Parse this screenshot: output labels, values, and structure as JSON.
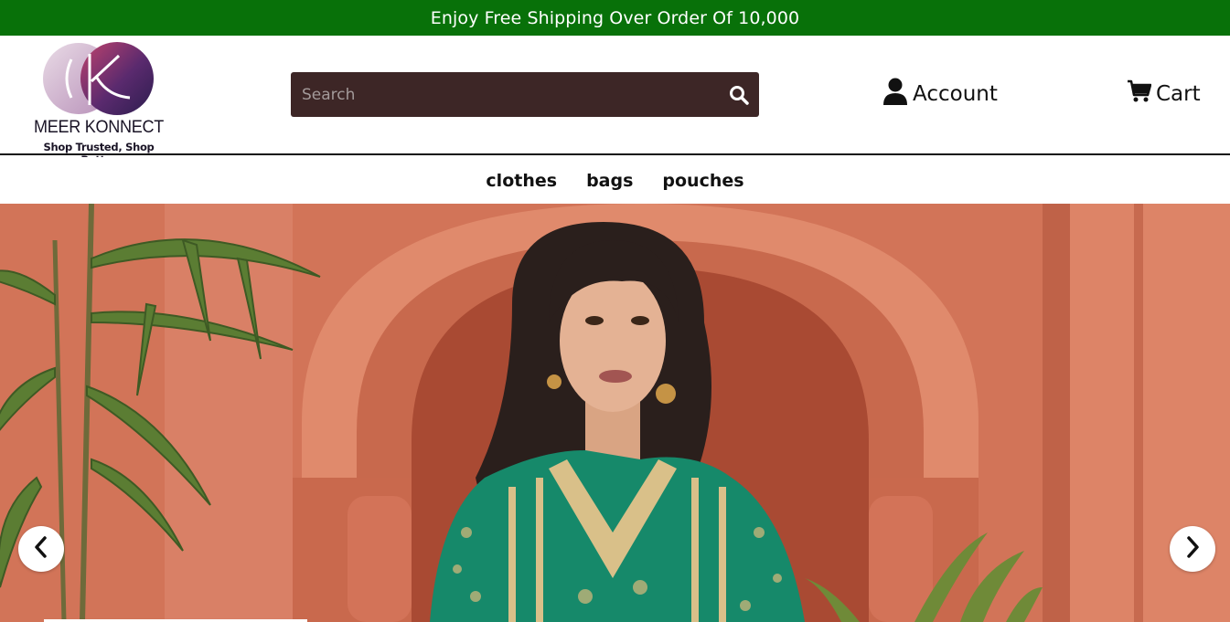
{
  "promo": {
    "text": "Enjoy Free Shipping Over Order Of 10,000"
  },
  "brand": {
    "name": "MEER KONNECT",
    "tagline": "Shop Trusted, Shop Better"
  },
  "search": {
    "placeholder": "Search",
    "value": ""
  },
  "header_links": {
    "account": "Account",
    "cart": "Cart"
  },
  "nav": {
    "items": [
      "clothes",
      "bags",
      "pouches"
    ]
  },
  "hero": {
    "slide_count_visible": 1
  },
  "icons": {
    "search": "search-icon",
    "account": "user-icon",
    "cart": "cart-icon",
    "prev": "chevron-left-icon",
    "next": "chevron-right-icon"
  },
  "colors": {
    "promo_bg": "#087109",
    "search_bg": "#3d2626",
    "hero_wall": "#d67a5e",
    "dress": "#16896a"
  }
}
